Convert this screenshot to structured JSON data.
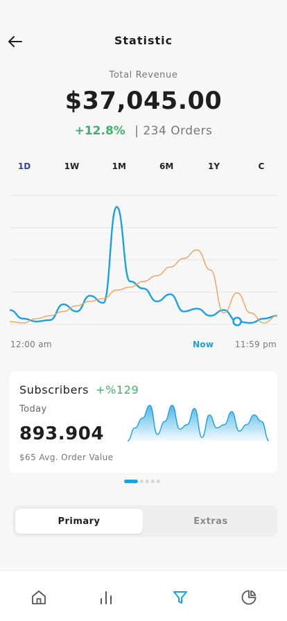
{
  "header": {
    "title": "Statistic",
    "back_icon": "arrow-left-icon"
  },
  "revenue": {
    "label": "Total Revenue",
    "value": "$37,045.00",
    "growth": "+12.8%",
    "orders": "| 234 Orders"
  },
  "ranges": [
    {
      "label": "1D",
      "active": true
    },
    {
      "label": "1W",
      "active": false
    },
    {
      "label": "1M",
      "active": false
    },
    {
      "label": "6M",
      "active": false
    },
    {
      "label": "1Y",
      "active": false
    },
    {
      "label": "C",
      "active": false
    }
  ],
  "chart_data": {
    "type": "line",
    "grid": true,
    "series": [
      {
        "color": "#1aa0e0",
        "values": [
          10,
          4,
          2,
          3,
          14,
          9,
          20,
          15,
          82,
          30,
          25,
          16,
          21,
          9,
          11,
          6,
          10,
          2,
          1,
          4,
          6
        ]
      },
      {
        "color": "#f0a05a",
        "values": [
          2,
          1,
          4,
          6,
          9,
          13,
          16,
          18,
          24,
          26,
          30,
          34,
          40,
          46,
          52,
          38,
          8,
          22,
          8,
          1,
          6
        ]
      }
    ],
    "x_ticks": [
      "12:00 am",
      "Now",
      "11:59 pm"
    ]
  },
  "subscribers": {
    "title": "Subscribers",
    "growth": "+%129",
    "period": "Today",
    "value": "893.904",
    "avg": "$65 Avg. Order Value",
    "spark_color": "#1aa0e0",
    "spark_values": [
      0,
      20,
      35,
      55,
      10,
      30,
      55,
      18,
      25,
      50,
      5,
      40,
      20,
      25,
      45,
      15,
      25,
      40,
      30,
      0
    ]
  },
  "pagination": {
    "total": 5,
    "active": 0
  },
  "segments": {
    "primary": "Primary",
    "extras": "Extras"
  },
  "tabbar": {
    "items": [
      {
        "icon": "home-icon"
      },
      {
        "icon": "bar-chart-icon"
      },
      {
        "icon": "filter-icon",
        "active": true
      },
      {
        "icon": "pie-chart-icon"
      }
    ],
    "active_color": "#1aa0e0",
    "inactive_color": "#555555"
  }
}
